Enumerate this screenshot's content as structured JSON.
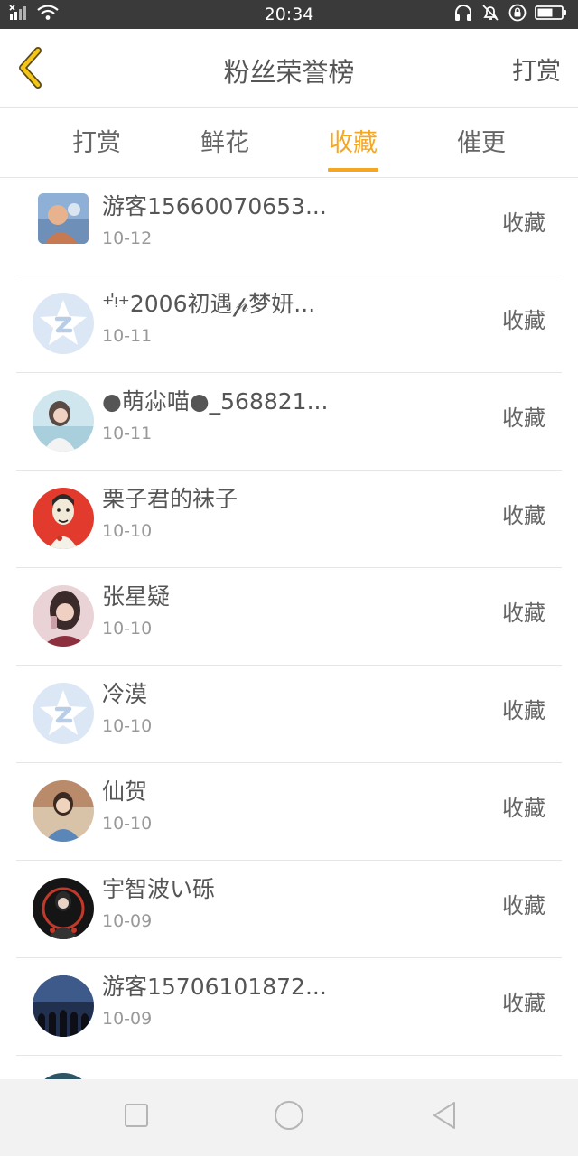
{
  "status_bar": {
    "time": "20:34"
  },
  "header": {
    "title": "粉丝荣誉榜",
    "action": "打赏"
  },
  "tabs": [
    {
      "label": "打赏"
    },
    {
      "label": "鲜花"
    },
    {
      "label": "收藏",
      "active": true
    },
    {
      "label": "催更"
    }
  ],
  "colors": {
    "accent": "#f5a623",
    "status_bar_bg": "#3a3a3a"
  },
  "list": [
    {
      "name": "游客15660070653...",
      "date": "10-12",
      "action": "收藏",
      "avatar": "photo-avatar"
    },
    {
      "name": "⁺ᵎ̍⁺2006初遇𝓅梦妍...",
      "date": "10-11",
      "action": "收藏",
      "avatar": "default-qq-avatar"
    },
    {
      "name": "●萌尛喵●_568821...",
      "date": "10-11",
      "action": "收藏",
      "avatar": "photo-avatar"
    },
    {
      "name": "栗子君的袜子",
      "date": "10-10",
      "action": "收藏",
      "avatar": "photo-avatar"
    },
    {
      "name": "张星疑",
      "date": "10-10",
      "action": "收藏",
      "avatar": "photo-avatar"
    },
    {
      "name": "冷漠",
      "date": "10-10",
      "action": "收藏",
      "avatar": "default-qq-avatar"
    },
    {
      "name": "仙贺",
      "date": "10-10",
      "action": "收藏",
      "avatar": "photo-avatar"
    },
    {
      "name": "宇智波い砾",
      "date": "10-09",
      "action": "收藏",
      "avatar": "photo-avatar"
    },
    {
      "name": "游客15706101872...",
      "date": "10-09",
      "action": "收藏",
      "avatar": "photo-avatar"
    },
    {
      "name": "",
      "date": "",
      "action": "",
      "avatar": "photo-avatar"
    }
  ]
}
